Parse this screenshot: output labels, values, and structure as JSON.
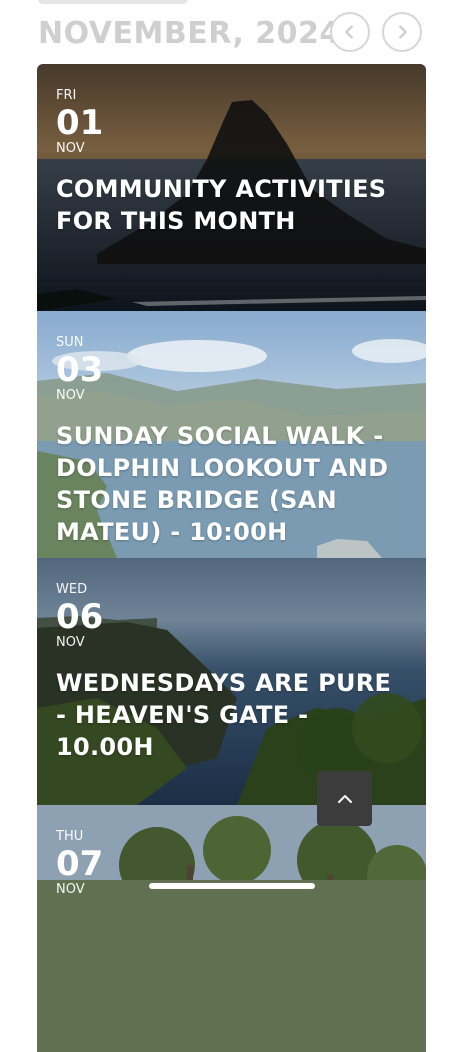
{
  "calendar": {
    "month_label": "NOVEMBER, 2024",
    "prev_icon": "chevron-left-icon",
    "next_icon": "chevron-right-icon"
  },
  "events": [
    {
      "dow": "FRI",
      "day": "01",
      "month": "NOV",
      "title": "COMMUNITY ACTIVITIES FOR THIS MONTH"
    },
    {
      "dow": "SUN",
      "day": "03",
      "month": "NOV",
      "title": "SUNDAY SOCIAL WALK - DOLPHIN LOOKOUT AND STONE BRIDGE (SAN MATEU) - 10:00H"
    },
    {
      "dow": "WED",
      "day": "06",
      "month": "NOV",
      "title": "WEDNESDAYS ARE PURE - HEAVEN'S GATE - 10.00H"
    },
    {
      "dow": "THU",
      "day": "07",
      "month": "NOV",
      "title": ""
    }
  ],
  "scroll_top": {
    "icon": "chevron-up-icon"
  },
  "colors": {
    "header_text": "#cfcfcf",
    "card_text": "#ffffff",
    "scroll_button": "#3c3c3c"
  }
}
